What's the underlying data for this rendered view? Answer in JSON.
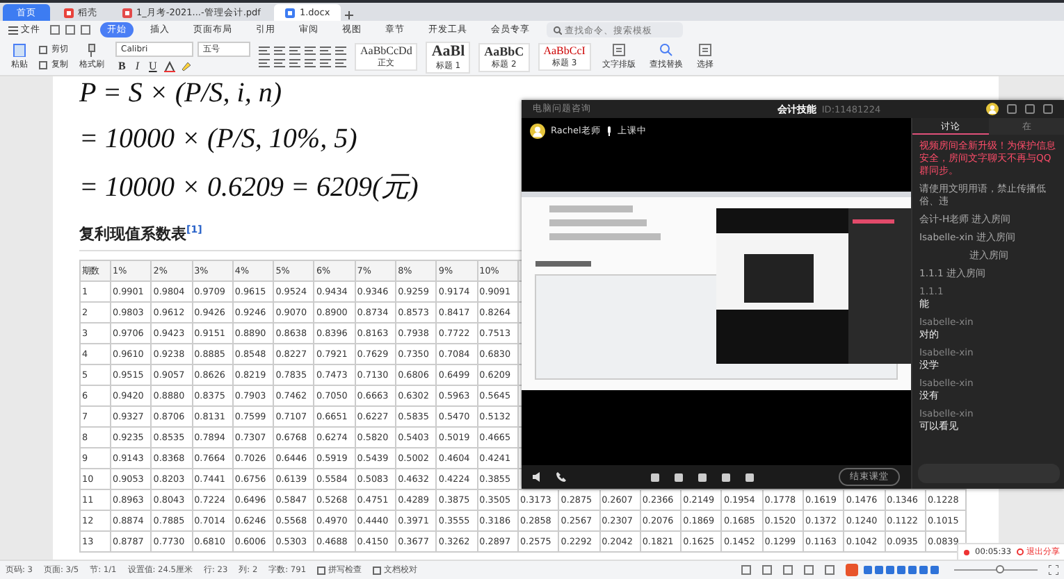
{
  "tabs": [
    {
      "label": "首页",
      "kind": "home",
      "selected": false
    },
    {
      "label": "稻壳",
      "kind": "app",
      "selected": false
    },
    {
      "label": "1_月考-2021...-管理会计.pdf",
      "kind": "pdf",
      "selected": false
    },
    {
      "label": "1.docx",
      "kind": "doc",
      "selected": true
    }
  ],
  "menu": {
    "file": "文件",
    "tabs": [
      {
        "label": "开始",
        "selected": true
      },
      {
        "label": "插入",
        "selected": false
      },
      {
        "label": "页面布局",
        "selected": false
      },
      {
        "label": "引用",
        "selected": false
      },
      {
        "label": "审阅",
        "selected": false
      },
      {
        "label": "视图",
        "selected": false
      },
      {
        "label": "章节",
        "selected": false
      },
      {
        "label": "开发工具",
        "selected": false
      },
      {
        "label": "会员专享",
        "selected": false
      }
    ],
    "search": {
      "placeholder": "查找命令、搜索模板"
    }
  },
  "toolbar": {
    "clipboard": [
      "粘贴",
      "剪切",
      "复制",
      "格式刷"
    ],
    "font": "Calibri",
    "size": "五号",
    "format": [
      {
        "label": "B",
        "kind": "bold"
      },
      {
        "label": "I",
        "kind": "italic"
      },
      {
        "label": "U",
        "kind": "underline"
      }
    ],
    "styles": [
      {
        "preview": "AaBbCcDd",
        "label": "正文"
      },
      {
        "preview": "AaBl",
        "label": "标题 1"
      },
      {
        "preview": "AaBbC",
        "label": "标题 2"
      },
      {
        "preview": "AaBbCcI",
        "label": "标题 3"
      }
    ],
    "tools": [
      "文字排版",
      "查找替换",
      "选择"
    ]
  },
  "document": {
    "formulas": [
      "P = S × (P/S, i, n)",
      "= 10000 × (P/S, 10%, 5)",
      "= 10000 × 0.6209 = 6209(元)"
    ],
    "heading": "复利现值系数表$^{[1]}$",
    "table": {
      "columns": [
        "期数",
        "1%",
        "2%",
        "3%",
        "4%",
        "5%",
        "6%",
        "7%",
        "8%",
        "9%",
        "10%"
      ],
      "rows": [
        [
          "1",
          "0.9901",
          "0.9804",
          "0.9709",
          "0.9615",
          "0.9524",
          "0.9434",
          "0.9346",
          "0.9259",
          "0.9174",
          "0.9091"
        ],
        [
          "2",
          "0.9803",
          "0.9612",
          "0.9426",
          "0.9246",
          "0.9070",
          "0.8900",
          "0.8734",
          "0.8573",
          "0.8417",
          "0.8264"
        ],
        [
          "3",
          "0.9706",
          "0.9423",
          "0.9151",
          "0.8890",
          "0.8638",
          "0.8396",
          "0.8163",
          "0.7938",
          "0.7722",
          "0.7513"
        ],
        [
          "4",
          "0.9610",
          "0.9238",
          "0.8885",
          "0.8548",
          "0.8227",
          "0.7921",
          "0.7629",
          "0.7350",
          "0.7084",
          "0.6830"
        ],
        [
          "5",
          "0.9515",
          "0.9057",
          "0.8626",
          "0.8219",
          "0.7835",
          "0.7473",
          "0.7130",
          "0.6806",
          "0.6499",
          "0.6209"
        ],
        [
          "6",
          "0.9420",
          "0.8880",
          "0.8375",
          "0.7903",
          "0.7462",
          "0.7050",
          "0.6663",
          "0.6302",
          "0.5963",
          "0.5645"
        ],
        [
          "7",
          "0.9327",
          "0.8706",
          "0.8131",
          "0.7599",
          "0.7107",
          "0.6651",
          "0.6227",
          "0.5835",
          "0.5470",
          "0.5132"
        ],
        [
          "8",
          "0.9235",
          "0.8535",
          "0.7894",
          "0.7307",
          "0.6768",
          "0.6274",
          "0.5820",
          "0.5403",
          "0.5019",
          "0.4665"
        ],
        [
          "9",
          "0.9143",
          "0.8368",
          "0.7664",
          "0.7026",
          "0.6446",
          "0.5919",
          "0.5439",
          "0.5002",
          "0.4604",
          "0.4241"
        ],
        [
          "10",
          "0.9053",
          "0.8203",
          "0.7441",
          "0.6756",
          "0.6139",
          "0.5584",
          "0.5083",
          "0.4632",
          "0.4224",
          "0.3855"
        ],
        [
          "11",
          "0.8963",
          "0.8043",
          "0.7224",
          "0.6496",
          "0.5847",
          "0.5268",
          "0.4751",
          "0.4289",
          "0.3875",
          "0.3505",
          "0.3173",
          "0.2875",
          "0.2607",
          "0.2366",
          "0.2149",
          "0.1954",
          "0.1778",
          "0.1619",
          "0.1476",
          "0.1346",
          "0.1228"
        ],
        [
          "12",
          "0.8874",
          "0.7885",
          "0.7014",
          "0.6246",
          "0.5568",
          "0.4970",
          "0.4440",
          "0.3971",
          "0.3555",
          "0.3186",
          "0.2858",
          "0.2567",
          "0.2307",
          "0.2076",
          "0.1869",
          "0.1685",
          "0.1520",
          "0.1372",
          "0.1240",
          "0.1122",
          "0.1015"
        ],
        [
          "13",
          "0.8787",
          "0.7730",
          "0.6810",
          "0.6006",
          "0.5303",
          "0.4688",
          "0.4150",
          "0.3677",
          "0.3262",
          "0.2897",
          "0.2575",
          "0.2292",
          "0.2042",
          "0.1821",
          "0.1625",
          "0.1452",
          "0.1299",
          "0.1163",
          "0.1042",
          "0.0935",
          "0.0839"
        ]
      ]
    }
  },
  "meeting": {
    "left_title": "电脑问题咨询",
    "title": "会计技能",
    "room_id": "ID:11481224",
    "host": "Rachel老师",
    "status": "上课中",
    "end_button": "结束课堂",
    "chat_tabs": [
      {
        "label": "讨论",
        "selected": true
      },
      {
        "label": "在",
        "selected": false
      }
    ],
    "messages": [
      {
        "kind": "notice",
        "text": "视频房间全新升级！为保护信息安全，房间文字聊天不再与QQ群同步。"
      },
      {
        "kind": "system",
        "text": "请使用文明用语，禁止传播低俗、违"
      },
      {
        "kind": "event",
        "text": "会计-H老师 进入房间"
      },
      {
        "kind": "event",
        "text": "Isabelle-xin 进入房间"
      },
      {
        "kind": "center",
        "text": "进入房间"
      },
      {
        "kind": "event",
        "text": "1.1.1 进入房间"
      },
      {
        "kind": "chat",
        "user": "1.1.1",
        "text": "能"
      },
      {
        "kind": "chat",
        "user": "Isabelle-xin",
        "text": "对的"
      },
      {
        "kind": "chat",
        "user": "Isabelle-xin",
        "text": "没学"
      },
      {
        "kind": "chat",
        "user": "Isabelle-xin",
        "text": "没有"
      },
      {
        "kind": "chat",
        "user": "Isabelle-xin",
        "text": "可以看见"
      }
    ]
  },
  "share_bar": {
    "time": "00:05:33",
    "exit": "退出分享"
  },
  "status_bar": {
    "items": [
      "页码: 3",
      "页面: 3/5",
      "节: 1/1",
      "设置值: 24.5厘米",
      "行: 23",
      "列: 2",
      "字数: 791"
    ],
    "buttons": [
      "拼写检查",
      "文档校对"
    ],
    "zoom": {
      "level": 0.55
    }
  }
}
